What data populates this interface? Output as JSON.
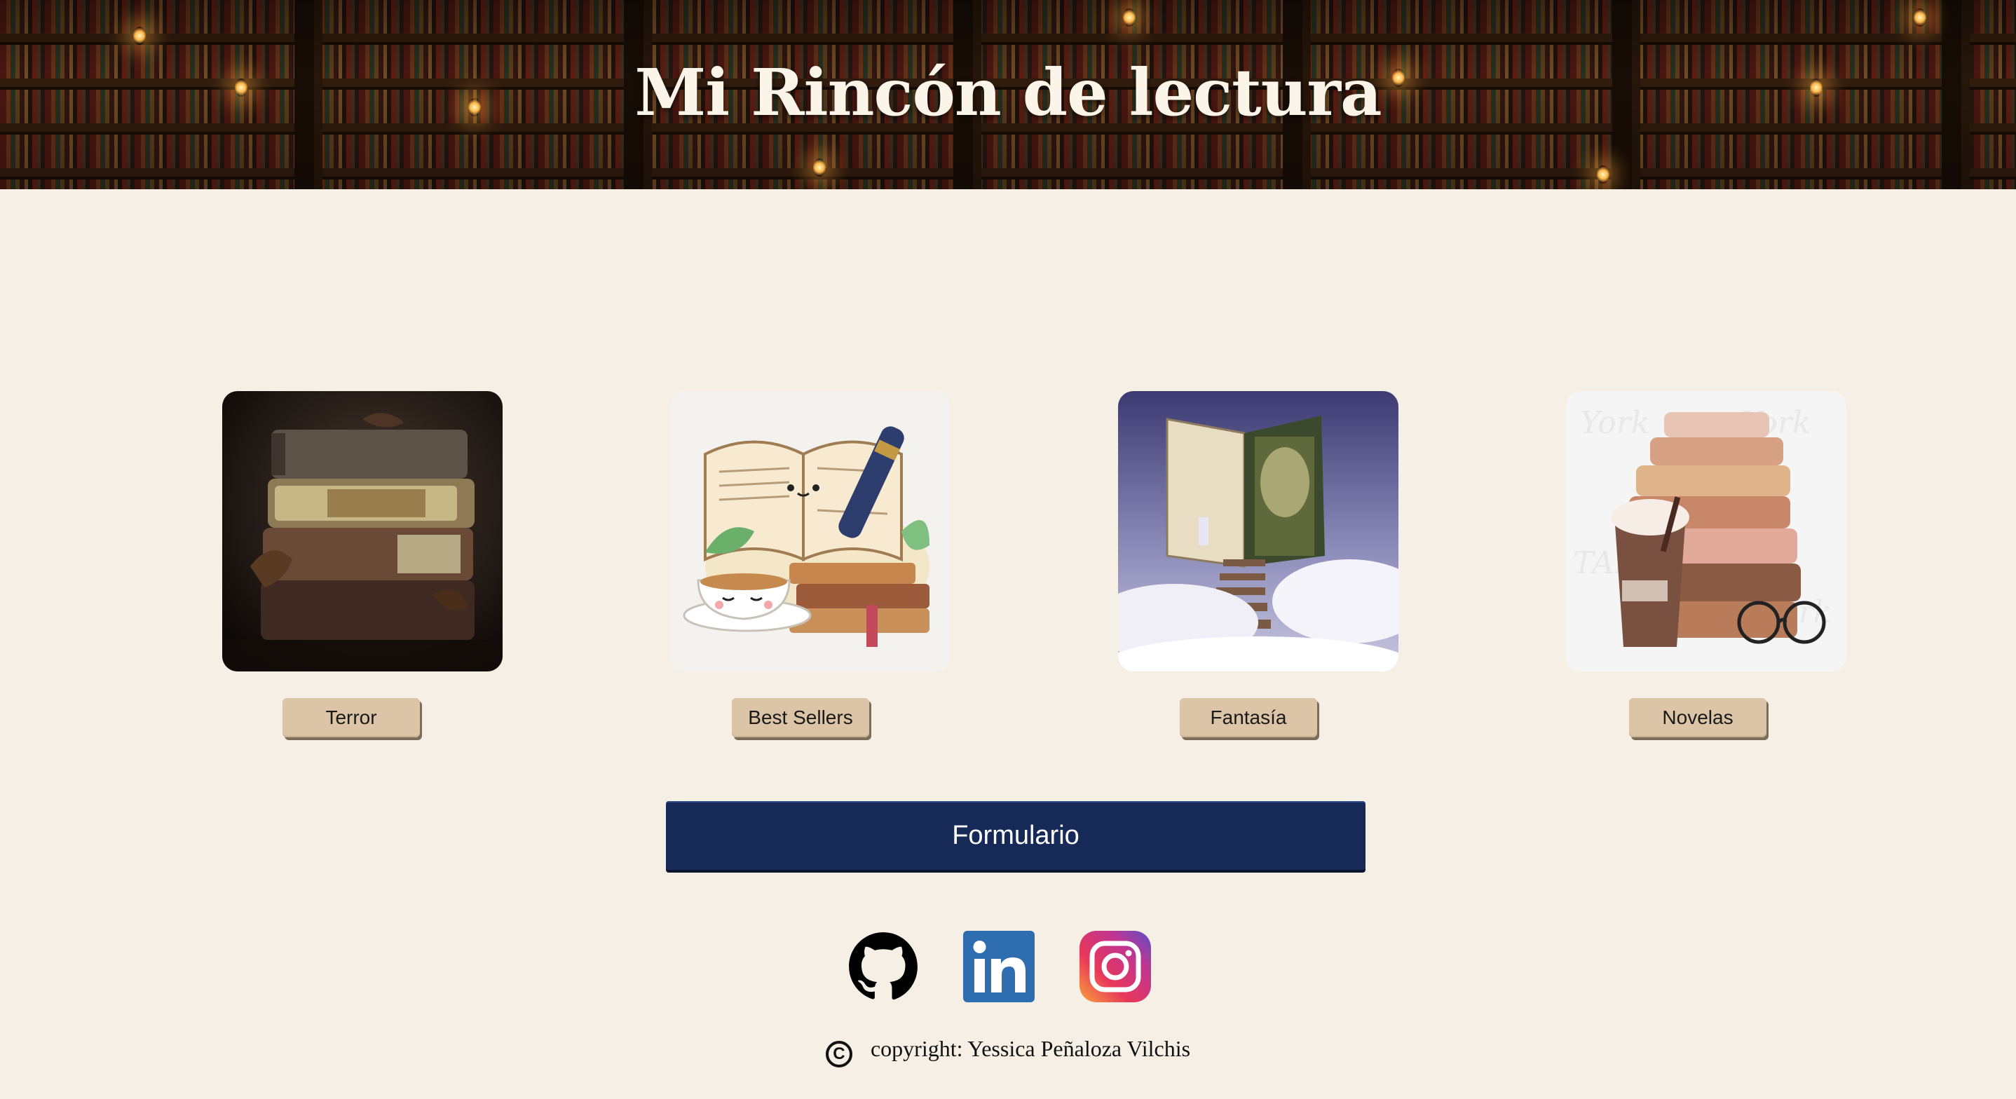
{
  "header": {
    "title": "Mi Rincón de lectura"
  },
  "categories": [
    {
      "label": "Terror",
      "image_icon": "dark-old-books-stack"
    },
    {
      "label": "Best Sellers",
      "image_icon": "book-pen-coffee-illustration"
    },
    {
      "label": "Fantasía",
      "image_icon": "book-stairs-clouds"
    },
    {
      "label": "Novelas",
      "image_icon": "books-coffee-glasses"
    }
  ],
  "form_button": {
    "label": "Formulario"
  },
  "socials": [
    {
      "icon": "github-icon"
    },
    {
      "icon": "linkedin-icon"
    },
    {
      "icon": "instagram-icon"
    }
  ],
  "footer": {
    "copyright_symbol": "C",
    "copyright": "copyright: Yessica Peñaloza Vilchis"
  },
  "colors": {
    "background": "#f6efe6",
    "category_button": "#dcc5a7",
    "form_button": "#172a57",
    "linkedin": "#2f6db1"
  }
}
